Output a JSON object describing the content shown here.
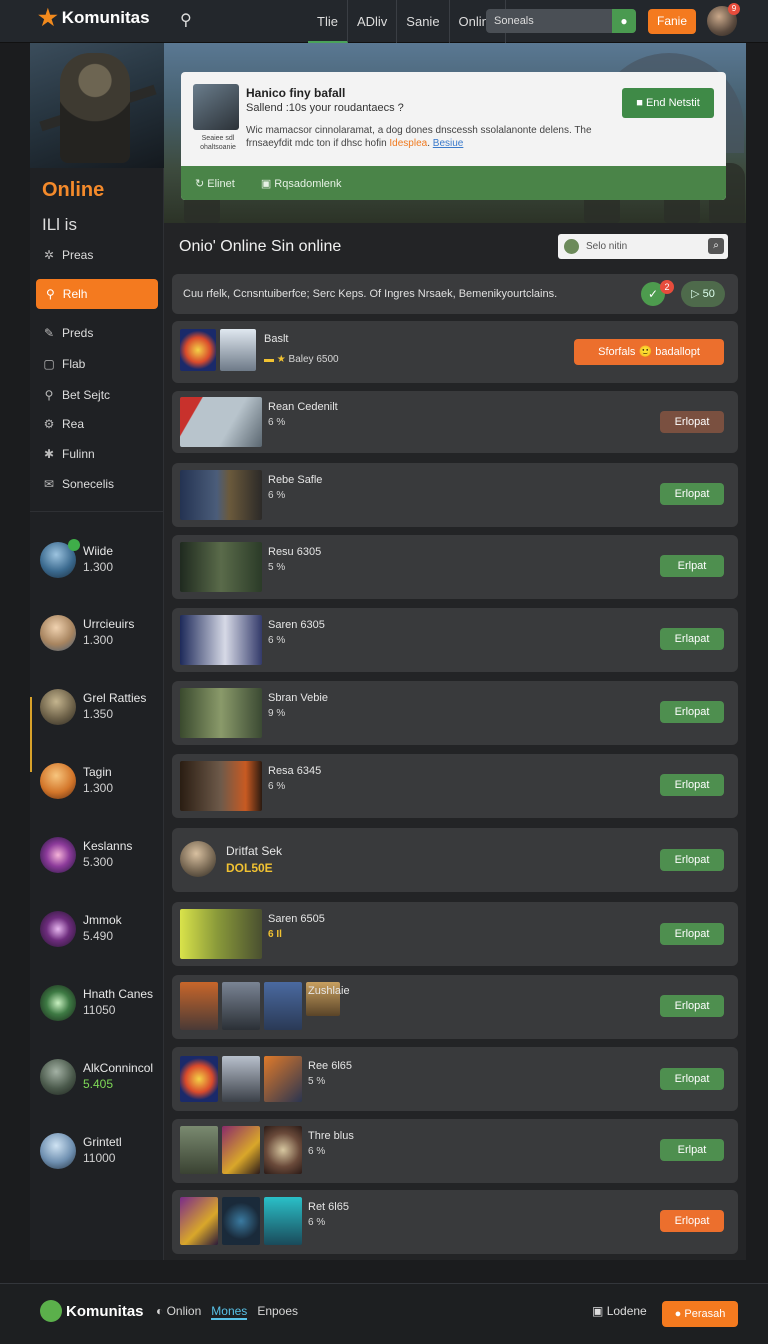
{
  "topbar": {
    "logo": "Komunitas",
    "tabs": [
      "Tlie",
      "ADliv",
      "Sanie",
      "Online"
    ],
    "search_placeholder": "Soneals",
    "cta": "Fanie"
  },
  "sidebar": {
    "title": "Online",
    "subtitle": "ILl is",
    "items_top": [
      {
        "label": "Preas",
        "icon": "sparkle-icon"
      }
    ],
    "active_item": {
      "label": "Relh",
      "icon": "search-icon"
    },
    "items": [
      {
        "label": "Preds",
        "icon": "pen-icon"
      },
      {
        "label": "Flab",
        "icon": "square-icon"
      },
      {
        "label": "Bet Sejtc",
        "icon": "search-icon"
      },
      {
        "label": "Rea",
        "icon": "gear-icon"
      },
      {
        "label": "Fulinn",
        "icon": "star-icon"
      },
      {
        "label": "Sonecelis",
        "icon": "chat-icon"
      }
    ],
    "players": [
      {
        "name": "Wiide",
        "score": "1.300"
      },
      {
        "name": "Urrcieuirs",
        "score": "1.300"
      },
      {
        "name": "Grel Ratties",
        "score": "1.350"
      },
      {
        "name": "Tagin",
        "score": "1.300"
      },
      {
        "name": "Keslanns",
        "score": "5.300"
      },
      {
        "name": "Jmmok",
        "score": "5.490"
      },
      {
        "name": "Hnath Canes",
        "score": "11050"
      },
      {
        "name": "AlkConnincol",
        "score": "5.405"
      },
      {
        "name": "Grintetl",
        "score": "11000"
      }
    ]
  },
  "hero_card": {
    "title": "Hanico finy bafall",
    "subtitle": "Sallend :10s your roudantaecs ?",
    "body": "Wic mamacsor cinnolaramat, a dog dones dnscessh ssolalanonte delens. The frnsaeyfdit mdc ton if dhsc hofin",
    "highlight": "Idesplea",
    "link": "Besiue",
    "thumb_caption": "Seaiee sdl ohaltsoanie",
    "end_button": "End Netstit",
    "footer_items": [
      {
        "label": "Elinet",
        "icon": "refresh-icon"
      },
      {
        "label": "Rqsadomlenk",
        "icon": "square-icon"
      }
    ]
  },
  "main": {
    "heading": "Onio' Online Sin online",
    "search_placeholder": "Selo nitin",
    "notice": "Cuu rfelk, Ccnsntuiberfce; Serc Keps. Of Ingres Nrsaek, Bemenikyourtclains.",
    "notice_badge": "2",
    "notice_pill": "50"
  },
  "rows": [
    {
      "name": "Baslt",
      "sub": "Baley 6500",
      "button": "Sforfals 🙂 badallopt",
      "btn_color": "o"
    },
    {
      "name": "Rean Cedenilt",
      "sub": "6 %",
      "button": "Erlopat",
      "btn_color": "b"
    },
    {
      "name": "Rebe Safle",
      "sub": "6 %",
      "button": "Erlopat",
      "btn_color": "g"
    },
    {
      "name": "Resu 6305",
      "sub": "5 %",
      "button": "Erlpat",
      "btn_color": "g"
    },
    {
      "name": "Saren 6305",
      "sub": "6 %",
      "button": "Erlapat",
      "btn_color": "g"
    },
    {
      "name": "Sbran Vebie",
      "sub": "9 %",
      "button": "Erlopat",
      "btn_color": "g"
    },
    {
      "name": "Resa 6345",
      "sub": "6 %",
      "button": "Erlopat",
      "btn_color": "g"
    },
    {
      "name": "Dritfat Sek",
      "sub": "DOL50E",
      "button": "Erlopat",
      "btn_color": "g"
    },
    {
      "name": "Saren 6505",
      "sub": "6 Il",
      "button": "Erlopat",
      "btn_color": "g"
    },
    {
      "name": "Zushlaie",
      "sub": "",
      "button": "Erlopat",
      "btn_color": "g"
    },
    {
      "name": "Ree 6l65",
      "sub": "5 %",
      "button": "Erlopat",
      "btn_color": "g"
    },
    {
      "name": "Thre blus",
      "sub": "6 %",
      "button": "Erlpat",
      "btn_color": "g"
    },
    {
      "name": "Ret 6l65",
      "sub": "6 %",
      "button": "Erlopat",
      "btn_color": "o"
    }
  ],
  "footer": {
    "logo": "Komunitas",
    "links": [
      "Onlion",
      "Mones",
      "Enpoes"
    ],
    "contact": "Lodene",
    "cta": "Perasah"
  }
}
